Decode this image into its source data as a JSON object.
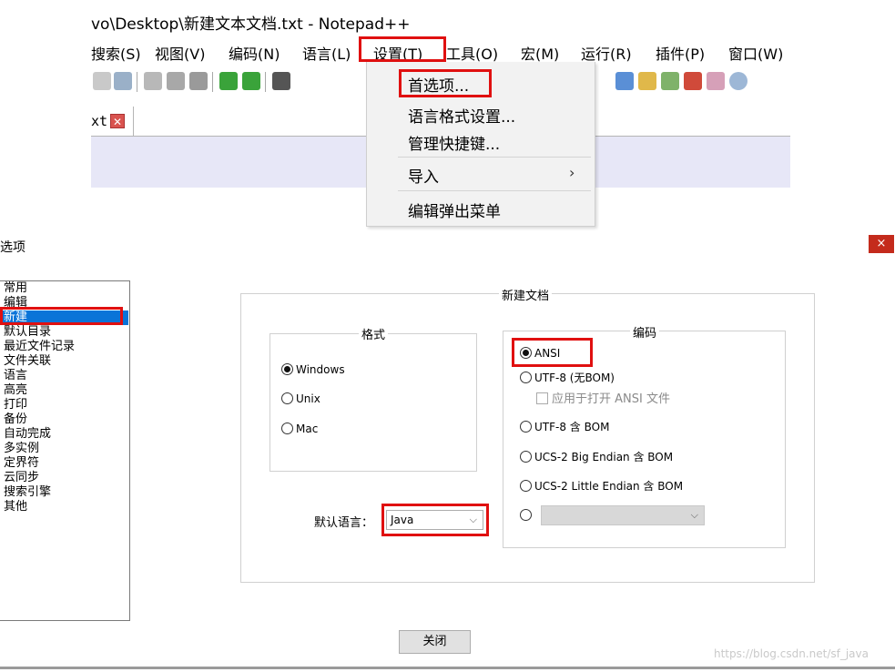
{
  "notepad": {
    "title": "vo\\Desktop\\新建文本文档.txt - Notepad++",
    "menu": [
      "搜索(S)",
      "视图(V)",
      "编码(N)",
      "语言(L)",
      "设置(T)",
      "工具(O)",
      "宏(M)",
      "运行(R)",
      "插件(P)",
      "窗口(W)"
    ],
    "tab_label": "xt",
    "tab_close": "✕",
    "settings_menu": {
      "items": [
        "首选项...",
        "语言格式设置...",
        "管理快捷键...",
        "导入",
        "编辑弹出菜单"
      ],
      "submenu_arrow": "›"
    }
  },
  "dialog": {
    "title": "选项",
    "close": "×",
    "categories": [
      "常用",
      "编辑",
      "新建",
      "默认目录",
      "最近文件记录",
      "文件关联",
      "语言",
      "高亮",
      "打印",
      "备份",
      "自动完成",
      "多实例",
      "定界符",
      "云同步",
      "搜索引擎",
      "其他"
    ],
    "selected_category": "新建",
    "new_doc_group": "新建文档",
    "format_group": {
      "title": "格式",
      "options": [
        "Windows",
        "Unix",
        "Mac"
      ],
      "selected": "Windows"
    },
    "encoding_group": {
      "title": "编码",
      "options": [
        "ANSI",
        "UTF-8 (无BOM)",
        "UTF-8 含 BOM",
        "UCS-2 Big Endian 含 BOM",
        "UCS-2 Little Endian 含 BOM"
      ],
      "selected": "ANSI",
      "apply_checkbox": "应用于打开 ANSI 文件",
      "apply_checked": false
    },
    "default_language_label": "默认语言：",
    "default_language_value": "Java",
    "close_button": "关闭"
  },
  "watermark": "https://blog.csdn.net/sf_java",
  "colors": {
    "highlight": "#e01010",
    "selection": "#0a74d8",
    "editor_bg": "#e7e7f7"
  }
}
